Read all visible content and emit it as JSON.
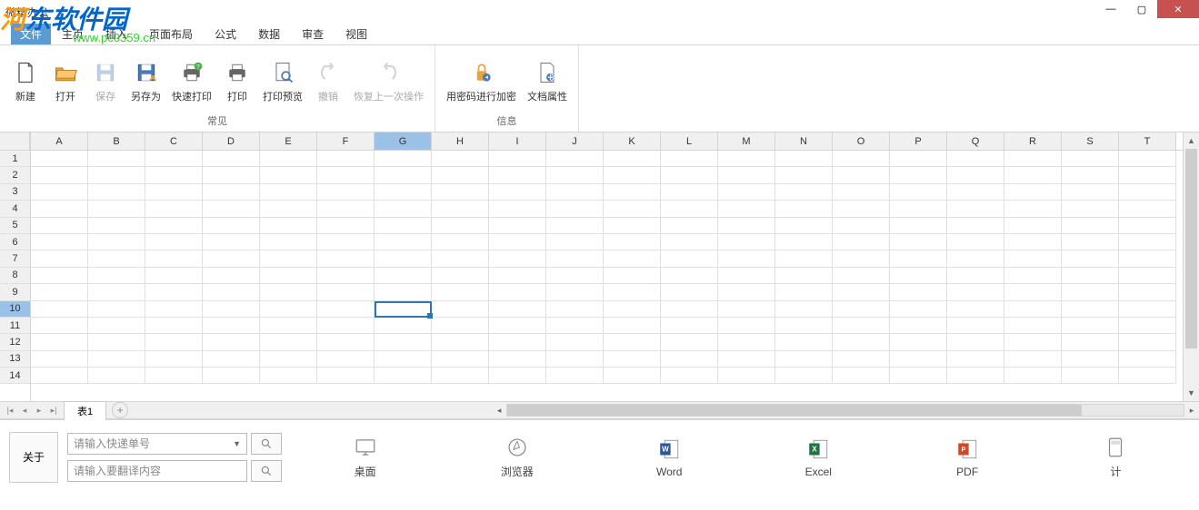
{
  "window": {
    "title": "微精办公",
    "watermark_text": "河东软件园",
    "watermark_url": "www.pc0359.cn"
  },
  "tabs": {
    "file": "文件",
    "items": [
      "主页",
      "插入",
      "页面布局",
      "公式",
      "数据",
      "审查",
      "视图"
    ]
  },
  "ribbon": {
    "groups": [
      {
        "label": "常见",
        "buttons": [
          {
            "id": "new",
            "label": "新建",
            "icon": "file-new"
          },
          {
            "id": "open",
            "label": "打开",
            "icon": "folder-open"
          },
          {
            "id": "save",
            "label": "保存",
            "icon": "save",
            "disabled": true
          },
          {
            "id": "saveas",
            "label": "另存为",
            "icon": "save-as"
          },
          {
            "id": "quickprint",
            "label": "快速打印",
            "icon": "printer-quick"
          },
          {
            "id": "print",
            "label": "打印",
            "icon": "printer"
          },
          {
            "id": "preview",
            "label": "打印预览",
            "icon": "preview"
          },
          {
            "id": "undo",
            "label": "撤销",
            "icon": "undo",
            "disabled": true
          },
          {
            "id": "redo",
            "label": "恢复上一次操作",
            "icon": "redo",
            "disabled": true
          }
        ]
      },
      {
        "label": "信息",
        "buttons": [
          {
            "id": "encrypt",
            "label": "用密码进行加密",
            "icon": "lock"
          },
          {
            "id": "props",
            "label": "文档属性",
            "icon": "doc-props"
          }
        ]
      }
    ]
  },
  "sheet": {
    "columns": [
      "A",
      "B",
      "C",
      "D",
      "E",
      "F",
      "G",
      "H",
      "I",
      "J",
      "K",
      "L",
      "M",
      "N",
      "O",
      "P",
      "Q",
      "R",
      "S",
      "T"
    ],
    "rows": [
      "1",
      "2",
      "3",
      "4",
      "5",
      "6",
      "7",
      "8",
      "9",
      "10",
      "11",
      "12",
      "13",
      "14"
    ],
    "selected_col": "G",
    "selected_row": "10",
    "tab_name": "表1"
  },
  "bottom": {
    "about": "关于",
    "express_placeholder": "请输入快递单号",
    "translate_placeholder": "请输入要翻译内容",
    "launchers": [
      {
        "id": "desktop",
        "label": "桌面",
        "icon": "monitor"
      },
      {
        "id": "browser",
        "label": "浏览器",
        "icon": "compass"
      },
      {
        "id": "word",
        "label": "Word",
        "icon": "word"
      },
      {
        "id": "excel",
        "label": "Excel",
        "icon": "excel"
      },
      {
        "id": "pdf",
        "label": "PDF",
        "icon": "pdf"
      },
      {
        "id": "calc",
        "label": "计",
        "icon": "calc"
      }
    ]
  }
}
